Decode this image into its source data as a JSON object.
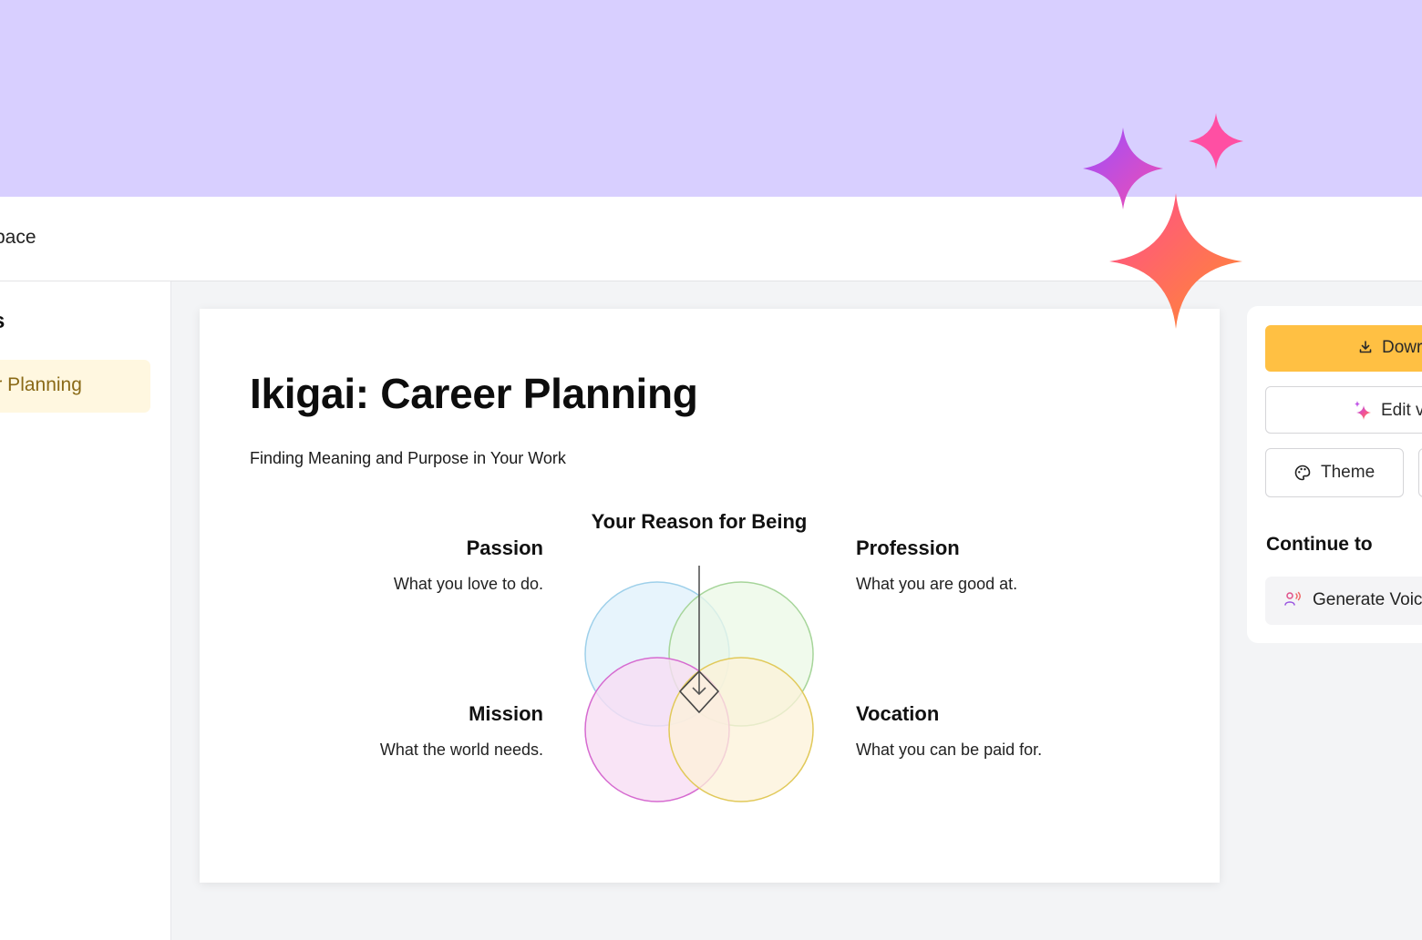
{
  "header": {
    "title": "pace"
  },
  "sidebar": {
    "heading": "s",
    "items": [
      {
        "label": "eer Planning",
        "active": true
      }
    ]
  },
  "slide": {
    "title": "Ikigai: Career Planning",
    "subtitle": "Finding Meaning and Purpose in Your Work",
    "diagram": {
      "center_title": "Your Reason for Being",
      "quadrants": [
        {
          "title": "Passion",
          "description": "What you love to do."
        },
        {
          "title": "Profession",
          "description": "What you are good at."
        },
        {
          "title": "Mission",
          "description": "What the world needs."
        },
        {
          "title": "Vocation",
          "description": "What you can be paid for."
        }
      ]
    }
  },
  "actions": {
    "download_label": "Dowr",
    "edit_label": "Edit v",
    "theme_label": "Theme",
    "continue_heading": "Continue to",
    "voice_label": "Generate Voic"
  },
  "colors": {
    "banner": "#d8cfff",
    "accent": "#ffc043",
    "sidebar_active_bg": "#fff7e0",
    "sidebar_active_text": "#8a6a17",
    "circle_passion": "#e3f2fb",
    "circle_profession": "#ebf8e6",
    "circle_mission": "#f7ddf4",
    "circle_vocation": "#fcf2d8"
  },
  "icons": {
    "download": "download-icon",
    "edit": "sparkle-icon",
    "theme": "palette-icon",
    "voice": "voice-icon",
    "decoration": "sparkles-decoration"
  }
}
